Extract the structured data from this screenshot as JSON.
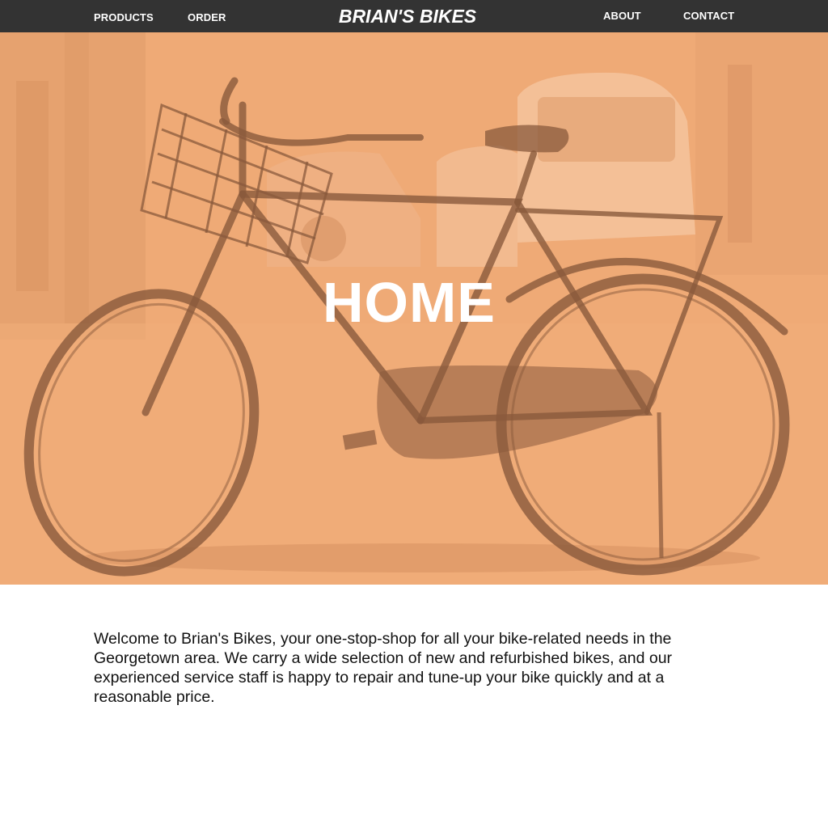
{
  "nav": {
    "products": "PRODUCTS",
    "order": "ORDER",
    "brand": "BRIAN'S BIKES",
    "about": "ABOUT",
    "contact": "CONTACT"
  },
  "hero": {
    "title": "HOME",
    "image": "bicycle-photo"
  },
  "intro": {
    "text": "Welcome to Brian's Bikes, your one-stop-shop for all your bike-related needs in the Georgetown area. We carry a wide selection of new and refurbished bikes, and our experienced service staff is happy to repair and tune-up your bike quickly and at a reasonable price."
  },
  "colors": {
    "navbar": "#333333",
    "hero_overlay": "#efaa76",
    "text": "#111111"
  }
}
